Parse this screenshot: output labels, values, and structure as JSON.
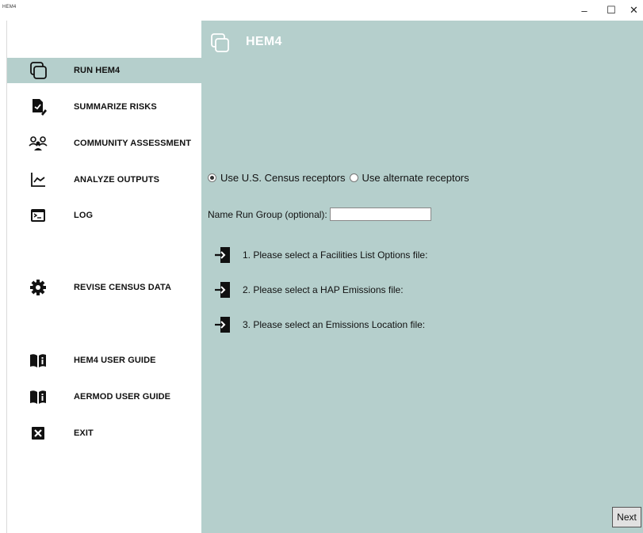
{
  "window": {
    "icon_label": "HEM4",
    "minimize_glyph": "–",
    "maximize_glyph": "☐",
    "close_glyph": "✕"
  },
  "sidebar": {
    "items": [
      {
        "label": "RUN HEM4",
        "icon": "run-window-icon",
        "active": true
      },
      {
        "label": "SUMMARIZE RISKS",
        "icon": "summarize-document-icon",
        "active": false
      },
      {
        "label": "COMMUNITY ASSESSMENT",
        "icon": "community-people-icon",
        "active": false
      },
      {
        "label": "ANALYZE OUTPUTS",
        "icon": "line-chart-icon",
        "active": false
      },
      {
        "label": "LOG",
        "icon": "terminal-icon",
        "active": false
      },
      {
        "label": "REVISE CENSUS DATA",
        "icon": "gear-icon",
        "active": false
      },
      {
        "label": "HEM4 USER GUIDE",
        "icon": "book-info-icon",
        "active": false
      },
      {
        "label": "AERMOD USER GUIDE",
        "icon": "book-info-icon",
        "active": false
      },
      {
        "label": "EXIT",
        "icon": "close-box-icon",
        "active": false
      }
    ]
  },
  "main": {
    "title": "HEM4",
    "receptors": {
      "option_census": "Use U.S. Census receptors",
      "option_alternate": "Use alternate receptors",
      "selected": "census"
    },
    "run_group": {
      "label": "Name Run Group (optional):",
      "value": ""
    },
    "files": [
      {
        "label": "1. Please select a Facilities List Options file:"
      },
      {
        "label": "2. Please select a HAP Emissions file:"
      },
      {
        "label": "3. Please select an Emissions Location file:"
      }
    ],
    "next_label": "Next"
  },
  "colors": {
    "accent_panel": "#b5cfcc",
    "header_text": "#ffffff"
  }
}
